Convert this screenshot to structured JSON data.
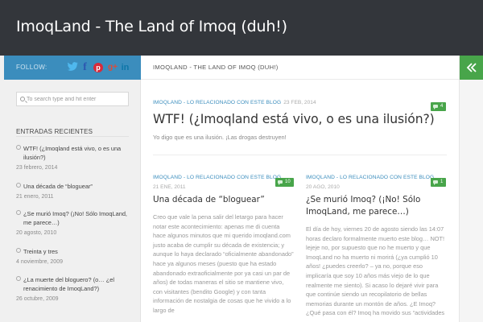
{
  "site": {
    "title": "ImoqLand - The Land of Imoq (duh!)"
  },
  "sidebar": {
    "follow_label": "FOLLOW:",
    "social": [
      {
        "icon": "twitter-icon",
        "glyph": "🐦"
      },
      {
        "icon": "facebook-icon",
        "glyph": "f"
      },
      {
        "icon": "pinterest-icon",
        "glyph": "p"
      },
      {
        "icon": "google-plus-icon",
        "glyph": "g+"
      },
      {
        "icon": "linkedin-icon",
        "glyph": "in"
      }
    ],
    "search_placeholder": "To search type and hit enter",
    "recent_title": "ENTRADAS RECIENTES",
    "recent": [
      {
        "title": "WTF! (¿Imoqland está vivo, o es una ilusión?)",
        "date": "23 febrero, 2014"
      },
      {
        "title": "Una década de “bloguear”",
        "date": "21 enero, 2011"
      },
      {
        "title": "¿Se murió Imoq? (¡No! Sólo ImoqLand, me parece…)",
        "date": "20 agosto, 2010"
      },
      {
        "title": "Treinta y tres",
        "date": "4 noviembre, 2009"
      },
      {
        "title": "¿La muerte del bloguero? (o… ¿el renacimiento de ImoqLand?)",
        "date": "26 octubre, 2009"
      }
    ]
  },
  "content": {
    "breadcrumb": "IMOQLAND - THE LAND OF IMOQ (DUH!)",
    "featured": {
      "category": "IMOQLAND - LO RELACIONADO CON ESTE BLOG",
      "date": "23 FEB, 2014",
      "comments": "4",
      "title": "WTF! (¿Imoqland está vivo, o es una ilusión?)",
      "excerpt": "Yo digo que es una ilusión. ¡Las drogas destruyen!"
    },
    "posts": [
      {
        "category": "IMOQLAND - LO RELACIONADO CON ESTE BLOG",
        "date": "21 ENE, 2011",
        "comments": "10",
        "title": "Una década de “bloguear”",
        "excerpt": "Creo que vale la pena salir del letargo para hacer notar este acontecimiento: apenas me di cuenta hace algunos minutos que mi querido imoqland.com justo acaba de cumplir su década de existencia; y aunque lo haya declarado “oficialmente abandonado” hace ya algunos meses (puesto que ha estado abandonado extraoficialmente por ya casi un par de años) de todas maneras el sitio se mantiene vivo, con visitantes (bendito Google) y con tanta información de nostalgia de cosas que he vivido a lo largo de"
      },
      {
        "category": "IMOQLAND - LO RELACIONADO CON ESTE BLOG",
        "date": "20 AGO, 2010",
        "comments": "1",
        "title": "¿Se murió Imoq? (¡No! Sólo ImoqLand, me parece…)",
        "excerpt": "El día de hoy, viernes 20 de agosto siendo las 14:07 horas declaro formalmente muerto este blog… NOT! lejeje no, por supuesto que no he muerto y que ImoqLand no ha muerto ni morirá (¿ya cumplió 10 años! ¿puedes creerlo? – ya no, porque eso implicaría que soy 10 años más viejo de lo que realmente me siento). Si acaso lo dejaré vivir para que continúe siendo un recopilatorio de bellas memorias durante un montón de años. ¿E Imoq? ¿Qué pasa con él? Imoq ha movido sus “actividades"
      }
    ]
  },
  "colors": {
    "header": "#33363b",
    "accent_blue": "#3b8dbd",
    "accent_green": "#48a54a"
  }
}
